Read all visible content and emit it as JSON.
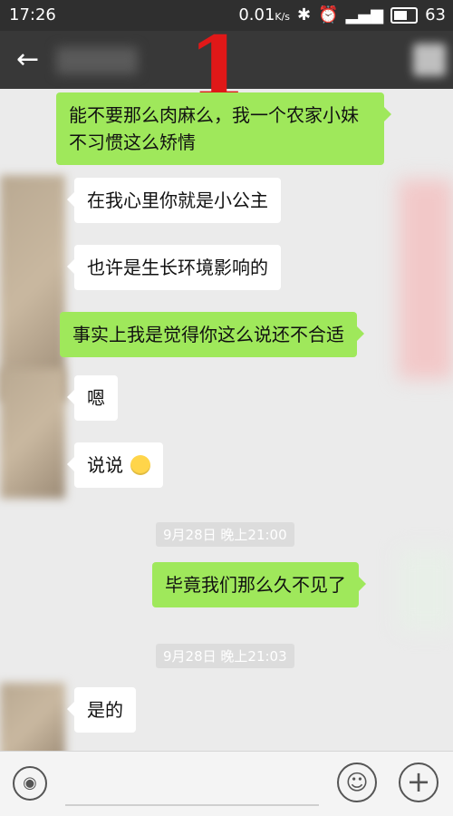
{
  "status_bar": {
    "time": "17:26",
    "speed": "0.01",
    "speed_unit": "K/s",
    "battery": "63"
  },
  "title_bar": {
    "back_icon": "arrow-left-icon",
    "overlay_number": "1"
  },
  "messages": [
    {
      "side": "out",
      "text": "能不要那么肉麻么，我一个农家小妹不习惯这么矫情"
    },
    {
      "side": "in",
      "text": "在我心里你就是小公主"
    },
    {
      "side": "in",
      "text": "也许是生长环境影响的"
    },
    {
      "side": "out",
      "text": "事实上我是觉得你这么说还不合适"
    },
    {
      "side": "in",
      "text": "嗯"
    },
    {
      "side": "in",
      "text": "说说"
    },
    {
      "side": "time",
      "text": "9月28日 晚上21:00"
    },
    {
      "side": "out",
      "text": "毕竟我们那么久不见了"
    },
    {
      "side": "time",
      "text": "9月28日 晚上21:03"
    },
    {
      "side": "in",
      "text": "是的"
    }
  ],
  "bottom_bar": {
    "voice_icon": "voice-icon",
    "emoji_icon": "emoji-icon",
    "plus_icon": "plus-icon"
  },
  "colors": {
    "outgoing_bubble": "#9fe85b",
    "incoming_bubble": "#ffffff",
    "overlay_number": "#e01818",
    "title_bar": "#383838"
  }
}
